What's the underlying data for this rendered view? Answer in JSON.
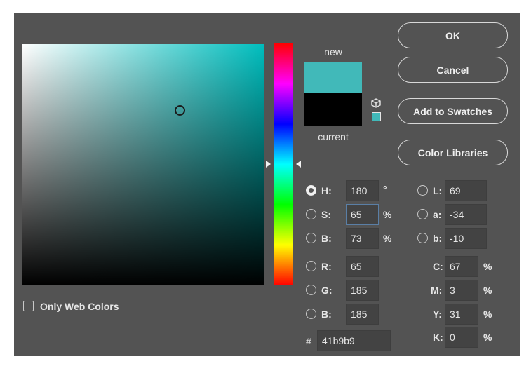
{
  "swatches": {
    "new_label": "new",
    "current_label": "current",
    "new_color": "#41b9b9",
    "current_color": "#000000"
  },
  "buttons": {
    "ok": "OK",
    "cancel": "Cancel",
    "add_to_swatches": "Add to Swatches",
    "color_libraries": "Color Libraries"
  },
  "hsb": {
    "h_label": "H:",
    "h_value": "180",
    "h_unit": "°",
    "s_label": "S:",
    "s_value": "65",
    "s_unit": "%",
    "b_label": "B:",
    "b_value": "73",
    "b_unit": "%"
  },
  "rgb": {
    "r_label": "R:",
    "r_value": "65",
    "g_label": "G:",
    "g_value": "185",
    "b_label": "B:",
    "b_value": "185"
  },
  "lab": {
    "l_label": "L:",
    "l_value": "69",
    "a_label": "a:",
    "a_value": "-34",
    "b_label": "b:",
    "b_value": "-10"
  },
  "cmyk": {
    "c_label": "C:",
    "c_value": "67",
    "m_label": "M:",
    "m_value": "3",
    "y_label": "Y:",
    "y_value": "31",
    "k_label": "K:",
    "k_value": "0",
    "unit": "%"
  },
  "hex": {
    "label": "#",
    "value": "41b9b9"
  },
  "web_colors": {
    "label": "Only Web Colors",
    "checked": false
  },
  "selected_channel": "H",
  "icons": {
    "cube": "cube-icon",
    "websafe": "websafe-swatch"
  }
}
